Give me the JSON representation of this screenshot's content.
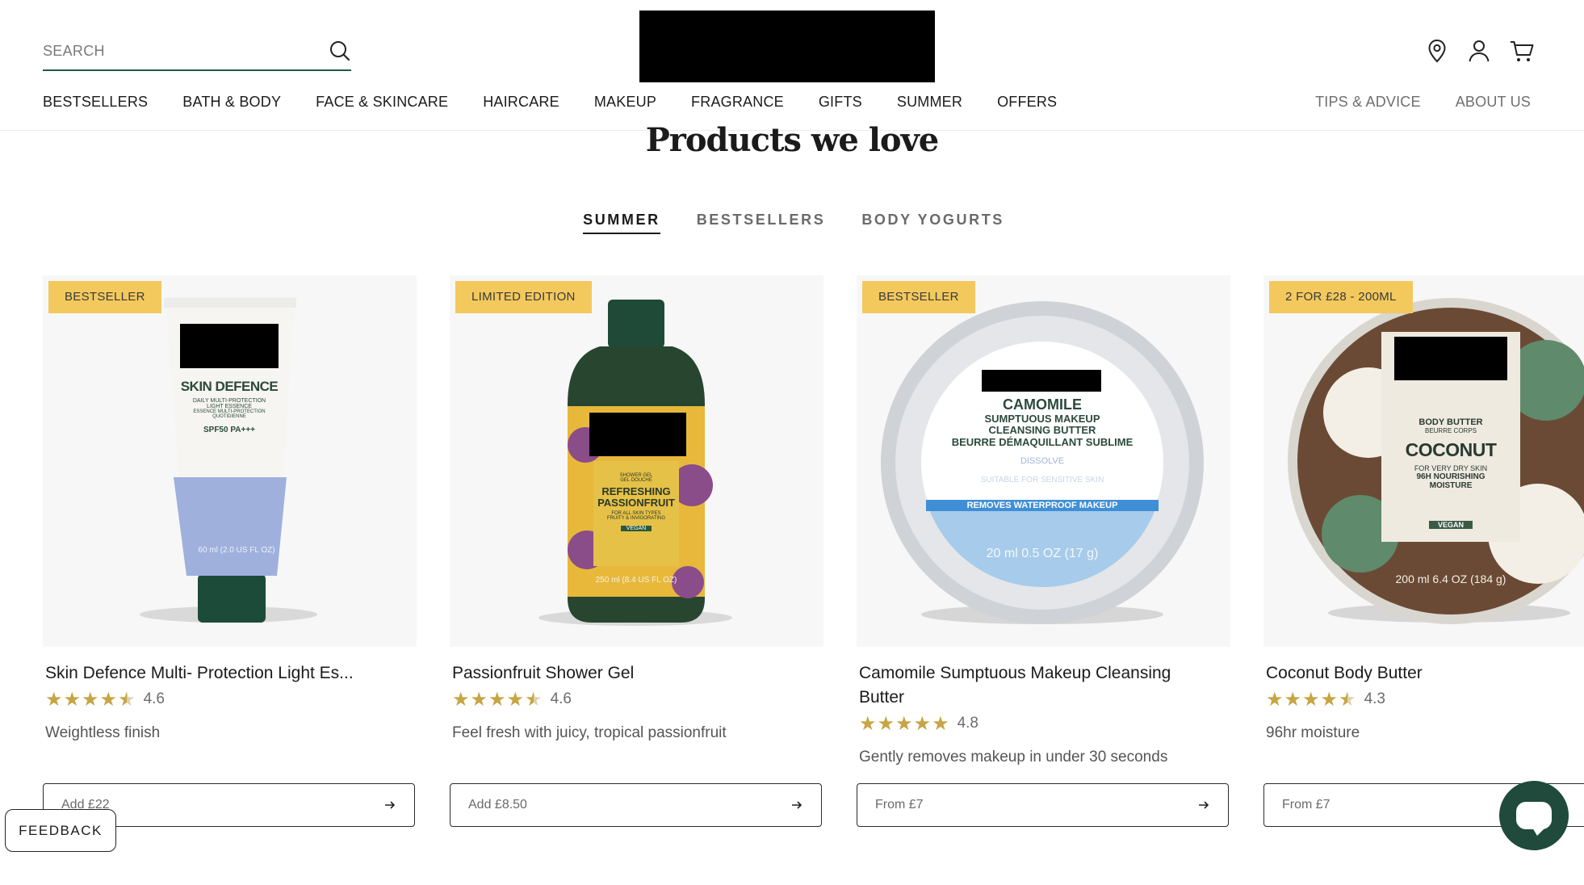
{
  "header": {
    "search_placeholder": "SEARCH",
    "nav_main": [
      "BESTSELLERS",
      "BATH & BODY",
      "FACE & SKINCARE",
      "HAIRCARE",
      "MAKEUP",
      "FRAGRANCE",
      "GIFTS",
      "SUMMER",
      "OFFERS"
    ],
    "nav_secondary": [
      "TIPS & ADVICE",
      "ABOUT US"
    ],
    "icons": [
      "search-icon",
      "location-pin-icon",
      "account-icon",
      "cart-icon"
    ]
  },
  "section": {
    "title": "Products we love",
    "tabs": [
      "SUMMER",
      "BESTSELLERS",
      "BODY YOGURTS"
    ],
    "active_tab": "SUMMER"
  },
  "products": [
    {
      "badge": "BESTSELLER",
      "name": "Skin Defence Multi- Protection Light Es...",
      "rating": "4.6",
      "rating_value": 4.6,
      "description": "Weightless finish",
      "button": "Add £22",
      "pack": {
        "title": "SKIN DEFENCE",
        "line1": "DAILY MULTI-PROTECTION",
        "line2": "LIGHT ESSENCE",
        "line3": "ESSENCE MULTI-PROTECTION",
        "line4": "QUOTIDIENNE",
        "spf": "SPF50 PA+++",
        "size": "60 ml (2.0 US FL OZ)"
      }
    },
    {
      "badge": "LIMITED EDITION",
      "name": "Passionfruit Shower Gel",
      "rating": "4.6",
      "rating_value": 4.6,
      "description": "Feel fresh with juicy, tropical passionfruit",
      "button": "Add £8.50",
      "pack": {
        "line1": "SHOWER GEL",
        "line2": "GEL DOUCHE",
        "title": "REFRESHING PASSIONFRUIT",
        "line3": "FOR ALL SKIN TYPES",
        "line4": "FRUITY & INVIGORATING",
        "vegan": "VEGAN",
        "size": "250 ml (8.4 US FL OZ)"
      }
    },
    {
      "badge": "BESTSELLER",
      "name": "Camomile Sumptuous Makeup Cleansing Butter",
      "rating": "4.8",
      "rating_value": 4.8,
      "description": "Gently removes makeup in under 30 seconds",
      "button": "From £7",
      "pack": {
        "title": "CAMOMILE",
        "line1": "SUMPTUOUS MAKEUP",
        "line2": "CLEANSING BUTTER",
        "line3": "BEURRE DÉMAQUILLANT SUBLIME",
        "line4": "DISSOLVE",
        "line5": "SUITABLE FOR SENSITIVE SKIN",
        "band": "REMOVES WATERPROOF MAKEUP",
        "size": "20 ml 0.5 OZ (17 g)"
      }
    },
    {
      "badge": "2 FOR £28 - 200ML",
      "name": "Coconut Body Butter",
      "rating": "4.3",
      "rating_value": 4.3,
      "description": "96hr moisture",
      "button": "From £7",
      "pack": {
        "line1": "BODY BUTTER",
        "line2": "BEURRE CORPS",
        "title": "COCONUT",
        "line3": "FOR VERY DRY SKIN",
        "line4": "96H NOURISHING",
        "line5": "MOISTURE",
        "vegan": "VEGAN",
        "size": "200 ml 6.4 OZ (184 g)"
      }
    }
  ],
  "feedback_label": "FEEDBACK",
  "colors": {
    "accent": "#1f5a48",
    "badge": "#f3c95e",
    "star": "#c7a543",
    "chat": "#1f4a3c"
  }
}
